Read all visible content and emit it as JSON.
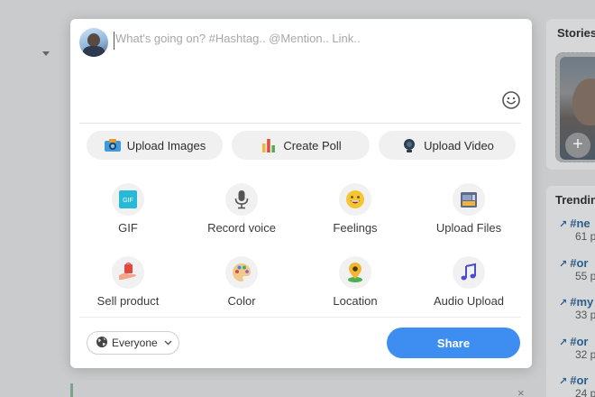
{
  "background": {
    "stories": {
      "title": "Stories",
      "add_label": "+"
    },
    "trending": {
      "title": "Trending",
      "items": [
        {
          "tag": "#ne",
          "count": "61 p"
        },
        {
          "tag": "#or",
          "count": "55 p"
        },
        {
          "tag": "#my",
          "count": "33 p"
        },
        {
          "tag": "#or",
          "count": "32 p"
        },
        {
          "tag": "#or",
          "count": "24 p"
        }
      ]
    },
    "close_glyph": "×"
  },
  "composer": {
    "placeholder": "What's going on? #Hashtag.. @Mention.. Link..",
    "value": ""
  },
  "actions": {
    "upload_images": "Upload Images",
    "create_poll": "Create Poll",
    "upload_video": "Upload Video"
  },
  "tools": {
    "gif": {
      "label": "GIF",
      "badge": "GIF"
    },
    "record_voice": {
      "label": "Record voice"
    },
    "feelings": {
      "label": "Feelings"
    },
    "upload_files": {
      "label": "Upload Files"
    },
    "sell_product": {
      "label": "Sell product"
    },
    "color": {
      "label": "Color"
    },
    "location": {
      "label": "Location"
    },
    "audio_upload": {
      "label": "Audio Upload"
    }
  },
  "footer": {
    "audience": "Everyone",
    "share": "Share"
  },
  "colors": {
    "accent": "#3d8ef0",
    "overlay": "#cacbcc"
  },
  "icons": {
    "emoji": "smiley-face-icon",
    "camera": "camera-icon",
    "poll": "bar-chart-icon",
    "video": "video-camera-icon",
    "gif": "gif-icon",
    "microphone": "microphone-icon",
    "feelings": "grinning-face-icon",
    "files": "folder-icon",
    "sell": "shopping-bag-hand-icon",
    "color": "palette-icon",
    "location": "map-pin-icon",
    "audio": "music-note-icon",
    "globe": "globe-icon"
  }
}
